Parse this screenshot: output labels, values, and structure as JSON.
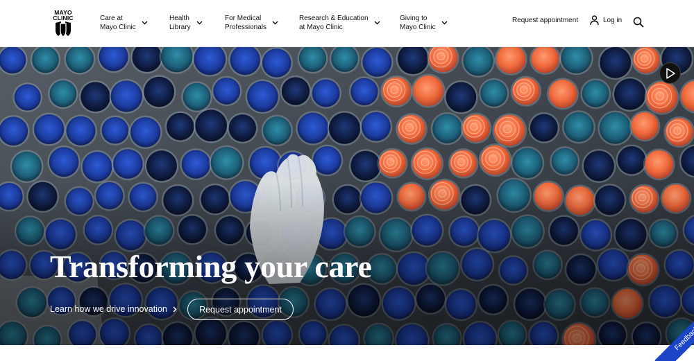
{
  "header": {
    "logo_text": "MAYO CLINIC",
    "nav": [
      {
        "line1": "Care at",
        "line2": "Mayo Clinic"
      },
      {
        "line1": "Health",
        "line2": "Library"
      },
      {
        "line1": "For Medical",
        "line2": "Professionals"
      },
      {
        "line1": "Research & Education",
        "line2": "at Mayo Clinic"
      },
      {
        "line1": "Giving to",
        "line2": "Mayo Clinic"
      }
    ],
    "request_appointment": "Request appointment",
    "login": "Log in"
  },
  "hero": {
    "title": "Transforming your care",
    "learn_link": "Learn how we drive innovation",
    "cta_button": "Request appointment"
  },
  "feedback": "Feedback",
  "colors": {
    "feedback_tab": "#1b44c8",
    "hero_text": "#ffffff"
  },
  "icons": [
    "chevron-down-icon",
    "user-icon",
    "search-icon",
    "chevron-right-icon",
    "play-icon"
  ]
}
